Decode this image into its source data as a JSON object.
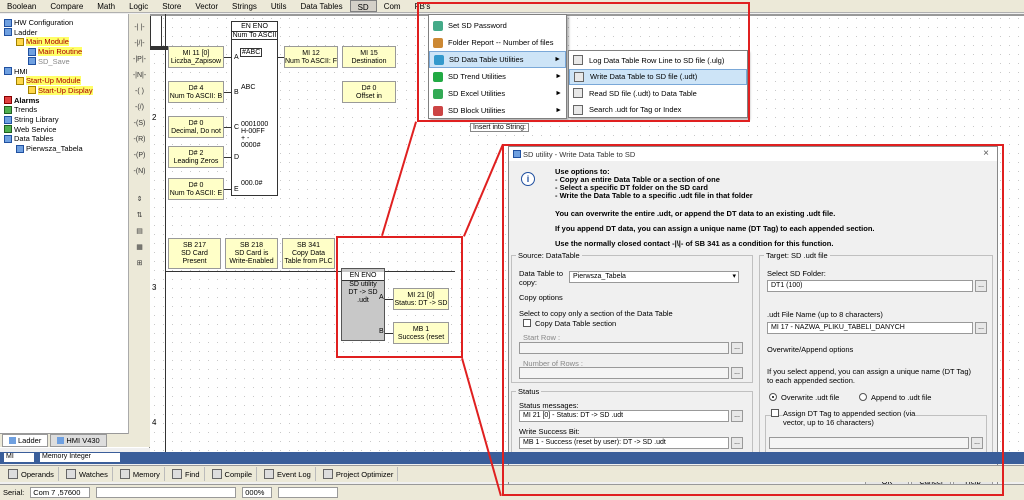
{
  "menubar": {
    "items": [
      "Boolean",
      "Compare",
      "Math",
      "Logic",
      "Store",
      "Vector",
      "Strings",
      "Utils",
      "Data Tables",
      "SD",
      "Com",
      "FB's"
    ],
    "active_index": 9
  },
  "tree": {
    "items": [
      {
        "label": "HW Configuration",
        "indent": 0,
        "icon": "hw-config-icon",
        "style": ""
      },
      {
        "label": "Ladder",
        "indent": 0,
        "icon": "ladder-icon",
        "style": ""
      },
      {
        "label": "Main Module",
        "indent": 1,
        "icon": "module-icon",
        "style": "hl"
      },
      {
        "label": "Main Routine",
        "indent": 2,
        "icon": "routine-icon",
        "style": "hl"
      },
      {
        "label": "SD_Save",
        "indent": 2,
        "icon": "routine-icon",
        "style": "g"
      },
      {
        "label": "HMI",
        "indent": 0,
        "icon": "hmi-icon",
        "style": ""
      },
      {
        "label": "Start-Up Module",
        "indent": 1,
        "icon": "module-icon",
        "style": "hl"
      },
      {
        "label": "Start-Up Display",
        "indent": 2,
        "icon": "display-icon",
        "style": "hl"
      },
      {
        "label": "Alarms",
        "indent": 0,
        "icon": "alarm-icon",
        "style": "bold"
      },
      {
        "label": "Trends",
        "indent": 0,
        "icon": "trends-icon",
        "style": ""
      },
      {
        "label": "String Library",
        "indent": 0,
        "icon": "string-library-icon",
        "style": ""
      },
      {
        "label": "Web Service",
        "indent": 0,
        "icon": "web-service-icon",
        "style": ""
      },
      {
        "label": "Data Tables",
        "indent": 0,
        "icon": "data-tables-icon",
        "style": ""
      },
      {
        "label": "Pierwsza_Tabela",
        "indent": 1,
        "icon": "table-icon",
        "style": ""
      }
    ],
    "tabs": [
      "Ladder",
      "HMI V430"
    ]
  },
  "ladder": {
    "rung2": {
      "number": "2",
      "func_header_en": "EN",
      "func_header_eno": "ENO",
      "func_name": "Num To ASCII",
      "inputs": [
        {
          "line1": "MI 11 [0]",
          "line2": "Liczba_Zapisow",
          "pin": "A"
        },
        {
          "line1": "D# 4",
          "line2": "Num To ASCII: B",
          "pin": "B"
        },
        {
          "line1": "D# 0",
          "line2": "Decimal, Do not",
          "pin": "C"
        },
        {
          "line1": "D# 2",
          "line2": "Leading Zeros",
          "pin": "D"
        },
        {
          "line1": "D# 0",
          "line2": "Num To ASCII: E",
          "pin": "E"
        }
      ],
      "inner": [
        "#ABC",
        "ABC",
        "0001000",
        "H-00FF",
        "+ -",
        "0000#",
        "000.0#"
      ],
      "outputs": [
        {
          "line1": "MI 12",
          "line2": "Num To ASCII: F"
        },
        {
          "line1": "MI 15",
          "line2": "Destination"
        },
        {
          "line1": "D# 0",
          "line2": "Offset in"
        }
      ],
      "insert_label": "Insert into String:"
    },
    "rung3": {
      "number": "3",
      "contacts": [
        {
          "line1": "SB 217",
          "line2": "SD Card",
          "line3": "Present"
        },
        {
          "line1": "SB 218",
          "line2": "SD Card is",
          "line3": "Write-Enabled"
        },
        {
          "line1": "SB 341",
          "line2": "Copy Data",
          "line3": "Table from PLC"
        }
      ],
      "func_header_en": "EN",
      "func_header_eno": "ENO",
      "func_lines": [
        "SD utility",
        "DT -> SD .udt"
      ],
      "pins": [
        "A",
        "B"
      ],
      "outputs": [
        {
          "line1": "MI 21 [0]",
          "line2": "Status: DT -> SD"
        },
        {
          "line1": "MB 1",
          "line2": "Success (reset"
        }
      ]
    },
    "rung4": {
      "number": "4"
    }
  },
  "sd_menu": {
    "items": [
      {
        "label": "Set SD Password",
        "has_sub": false
      },
      {
        "label": "Folder Report -- Number of files",
        "has_sub": false
      },
      {
        "label": "SD Data Table Utilities",
        "has_sub": true
      },
      {
        "label": "SD Trend Utilities",
        "has_sub": true
      },
      {
        "label": "SD Excel Utilities",
        "has_sub": true
      },
      {
        "label": "SD Block Utilities",
        "has_sub": true
      }
    ],
    "selected_index": 2,
    "arrow": "►"
  },
  "submenu": {
    "items": [
      {
        "label": "Log Data Table Row Line to SD file (.ulg)"
      },
      {
        "label": "Write Data Table to SD file (.udt)"
      },
      {
        "label": "Read SD file (.udt) to Data Table"
      },
      {
        "label": "Search .udt for Tag or Index"
      }
    ],
    "selected_index": 1
  },
  "dialog": {
    "title": "SD utility - Write Data Table to SD",
    "close": "×",
    "intro": [
      {
        "text": "Use options to:",
        "bold": true
      },
      {
        "text": "- Copy an entire Data Table or a section of one",
        "bold": true
      },
      {
        "text": "- Select a specific DT folder on the SD card",
        "bold": true
      },
      {
        "text": "- Write the Data Table to a specific .udt file in that folder",
        "bold": true
      },
      {
        "text": "You can overwrite the entire .udt, or append the DT data to an existing .udt file.",
        "bold": true
      },
      {
        "text": "If you append DT data, you can assign a unique name (DT Tag) to each appended section.",
        "bold": true
      },
      {
        "text": "Use the normally closed contact -|\\|- of SB 341 as a condition for this function.",
        "bold": true
      }
    ],
    "source": {
      "group_label": "Source: DataTable",
      "table_label_1": "Data Table to",
      "table_label_2": "copy:",
      "table_value": "Pierwsza_Tabela",
      "copy_options": "Copy options",
      "select_section": "Select to copy only a section of the Data Table",
      "copy_section_cb": "Copy Data Table section",
      "start_row": "Start Row :",
      "num_rows": "Number of Rows :"
    },
    "status": {
      "group_label": "Status",
      "messages_label": "Status messages:",
      "messages_value": "MI 21 [0] - Status: DT -> SD .udt",
      "success_label": "Write Success Bit:",
      "success_value": "MB 1  - Success (reset by user): DT -> SD .udt"
    },
    "target": {
      "group_label": "Target: SD .udt file",
      "folder_label": "Select SD Folder:",
      "folder_value": "DT1 (100)",
      "file_label": ".udt File Name (up to 8 characters)",
      "file_value": "MI 17  - NAZWA_PLIKU_TABELI_DANYCH",
      "overwrite_label": "Overwrite/Append options",
      "desc_1": "If you select append, you can assign a unique name (DT Tag)",
      "desc_2": "to each appended section.",
      "radio_overwrite": "Overwrite .udt file",
      "radio_append": "Append to .udt file",
      "assign_1": "Assign DT Tag to appended section (via",
      "assign_2": "vector, up to 16 characters)"
    },
    "buttons": {
      "ok": "OK",
      "cancel": "Cancel",
      "help": "Help"
    },
    "ellipsis": "..."
  },
  "bottombar": {
    "mi_label": "MI",
    "mi_value": "Memory Integer",
    "work_items": [
      "Operands",
      "Watches",
      "Memory",
      "Find",
      "Compile",
      "Event Log",
      "Project Optimizer"
    ]
  },
  "statusbar": {
    "serial": "Serial:",
    "com": "Com 7 ,57600",
    "zoom": "000%"
  }
}
